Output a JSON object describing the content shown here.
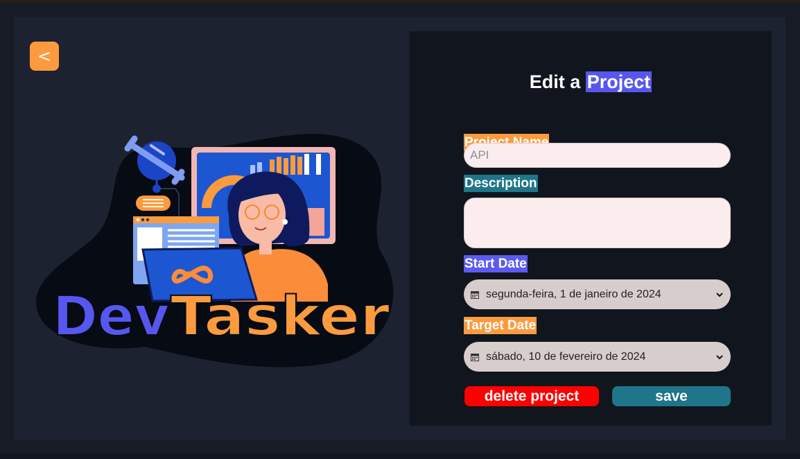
{
  "back_label": "<",
  "form": {
    "title_prefix": "Edit a",
    "title_highlight": "Project",
    "project_name_label": "Project Name",
    "project_name_placeholder": "API",
    "description_label": "Description",
    "description_value": "",
    "start_date_label": "Start Date",
    "start_date_value": "segunda-feira, 1 de janeiro de 2024",
    "target_date_label": "Target Date",
    "target_date_value": "sábado, 10 de fevereiro de 2024",
    "delete_label": "delete project",
    "save_label": "save"
  },
  "logo": {
    "text_dev": "Dev",
    "text_tasker": "Tasker"
  },
  "colors": {
    "accent_orange": "#fb9b3e",
    "accent_purple": "#5b5bf2",
    "accent_teal": "#1f7589",
    "danger": "#fd0000"
  },
  "icons": [
    "back-chevron-icon",
    "calendar-icon",
    "chevron-down-icon",
    "wrench-icon",
    "infinity-icon"
  ]
}
